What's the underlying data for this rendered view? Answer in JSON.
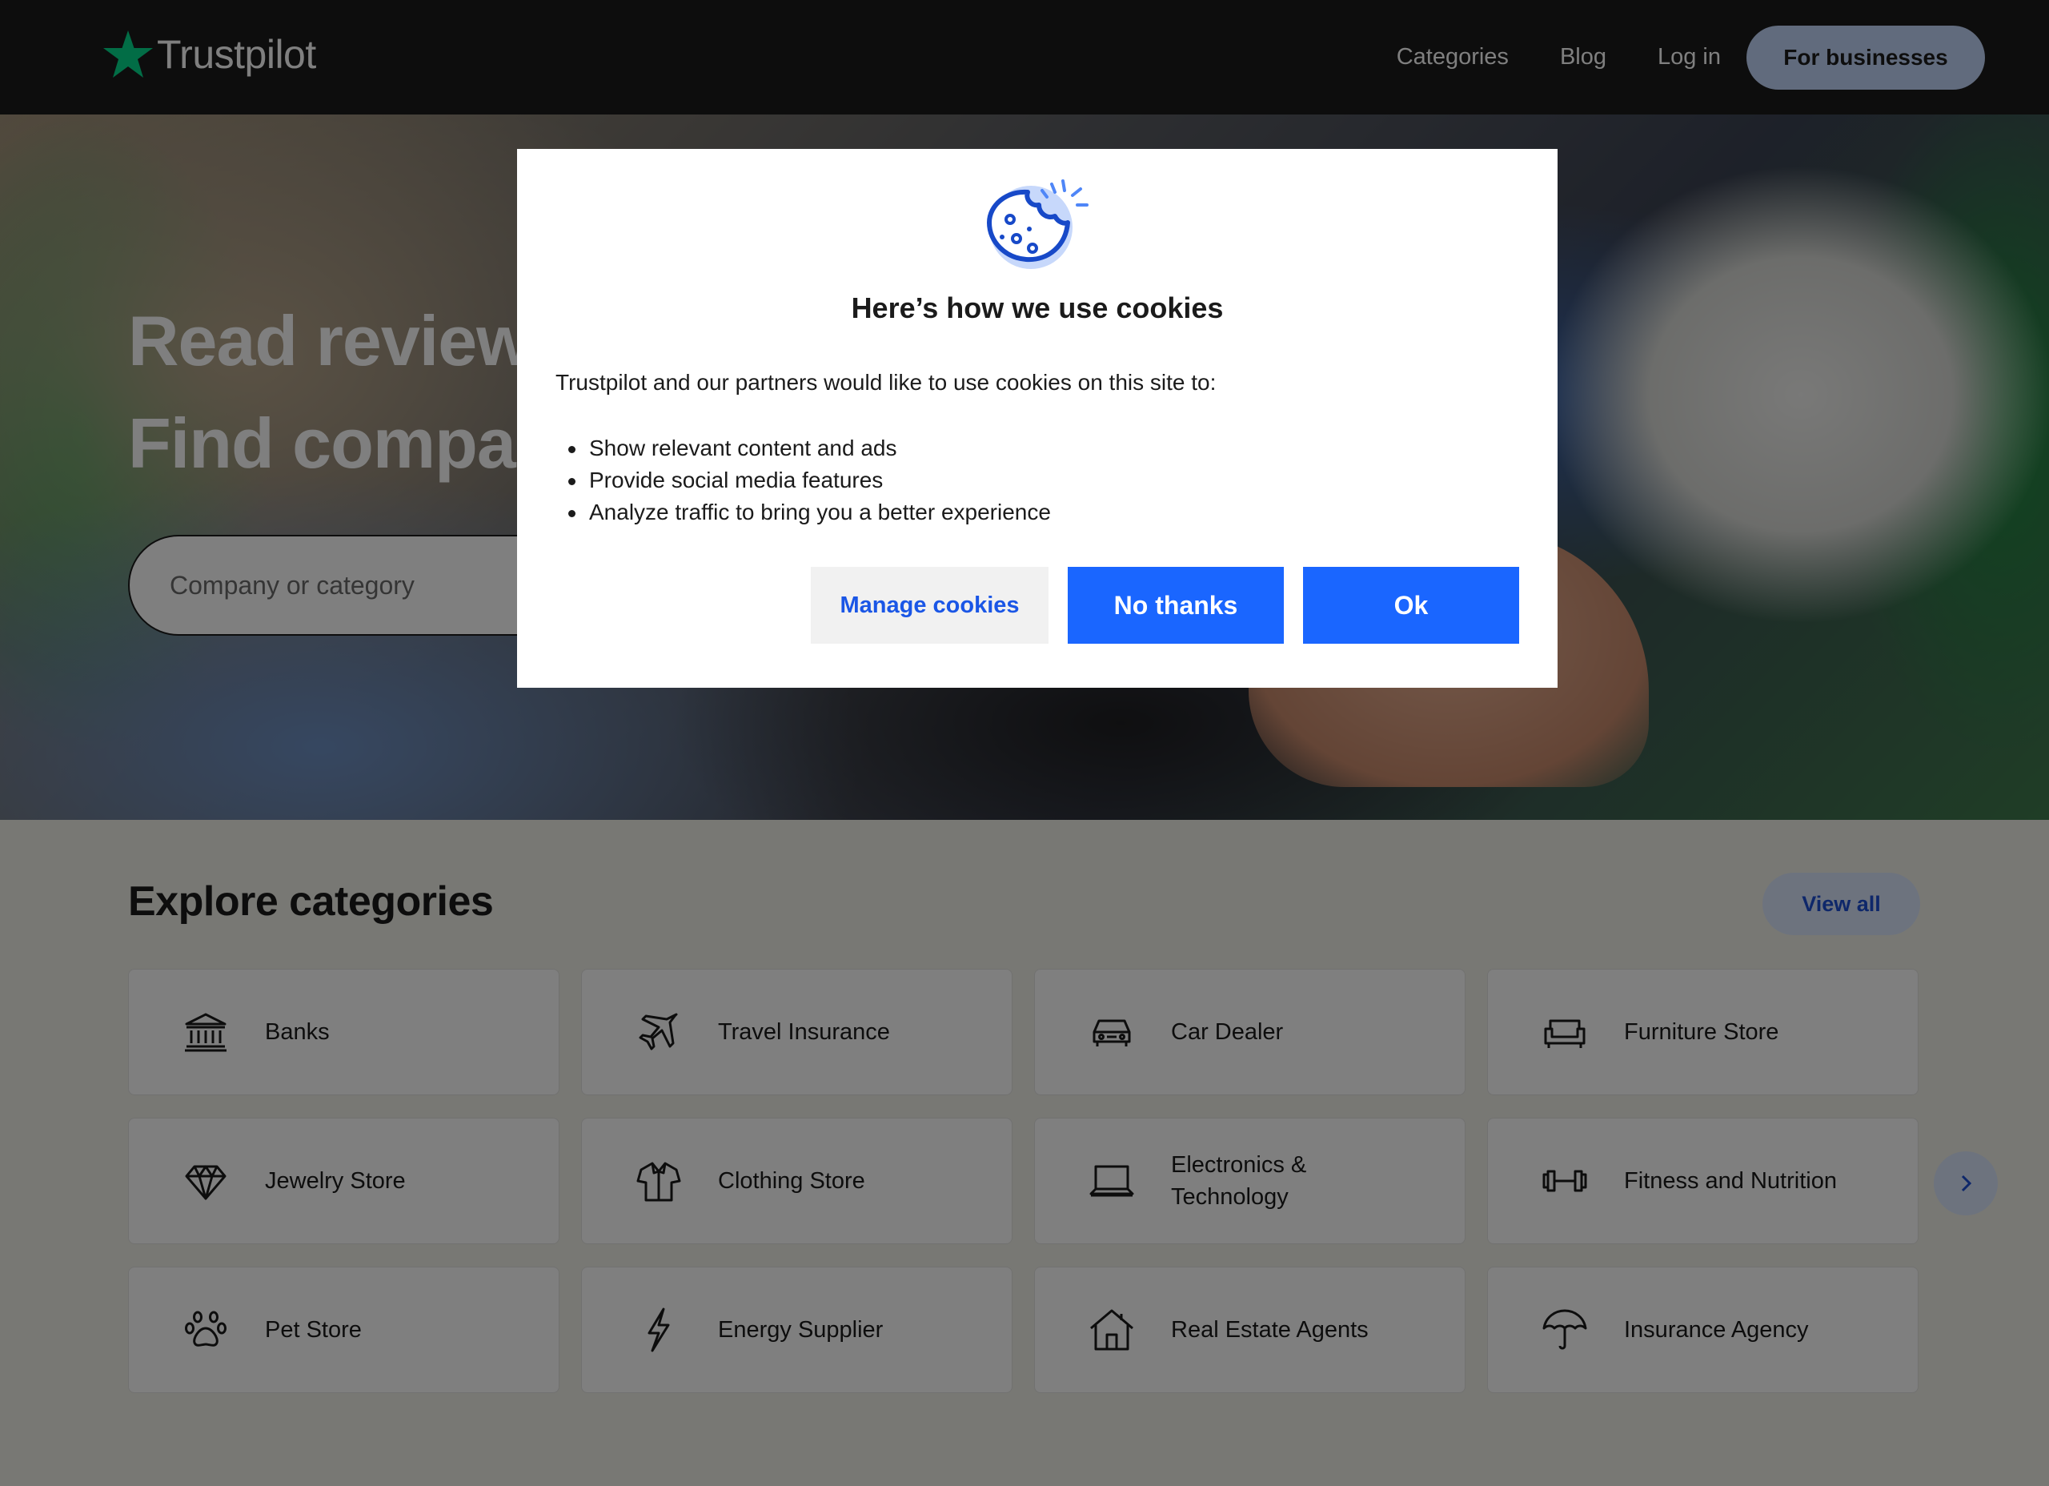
{
  "header": {
    "logo_text": "Trustpilot",
    "nav": {
      "categories": "Categories",
      "blog": "Blog",
      "login": "Log in",
      "for_businesses": "For businesses"
    }
  },
  "hero": {
    "title_line1": "Read reviews. Write reviews.",
    "title_line2": "Find companies you can trust.",
    "search_placeholder": "Company or category"
  },
  "categories": {
    "title": "Explore categories",
    "view_all": "View all",
    "items": [
      {
        "label": "Banks",
        "icon": "bank-icon"
      },
      {
        "label": "Travel Insurance",
        "icon": "airplane-icon"
      },
      {
        "label": "Car Dealer",
        "icon": "car-icon"
      },
      {
        "label": "Furniture Store",
        "icon": "sofa-icon"
      },
      {
        "label": "Jewelry Store",
        "icon": "diamond-icon"
      },
      {
        "label": "Clothing Store",
        "icon": "shirt-icon"
      },
      {
        "label": "Electronics & Technology",
        "icon": "laptop-icon"
      },
      {
        "label": "Fitness and Nutrition",
        "icon": "dumbbell-icon"
      },
      {
        "label": "Pet Store",
        "icon": "paw-icon"
      },
      {
        "label": "Energy Supplier",
        "icon": "lightning-icon"
      },
      {
        "label": "Real Estate Agents",
        "icon": "house-icon"
      },
      {
        "label": "Insurance Agency",
        "icon": "umbrella-icon"
      }
    ]
  },
  "cookie_modal": {
    "title": "Here’s how we use cookies",
    "intro": "Trustpilot and our partners would like to use cookies on this site to:",
    "bullets": [
      "Show relevant content and ads",
      "Provide social media features",
      "Analyze traffic to bring you a better experience"
    ],
    "buttons": {
      "manage": "Manage cookies",
      "no_thanks": "No thanks",
      "ok": "Ok"
    }
  },
  "colors": {
    "brand_green": "#04da8d",
    "primary_blue": "#1a66ff",
    "header_bg": "#1b1b1b",
    "section_bg": "#f1f1e8"
  }
}
